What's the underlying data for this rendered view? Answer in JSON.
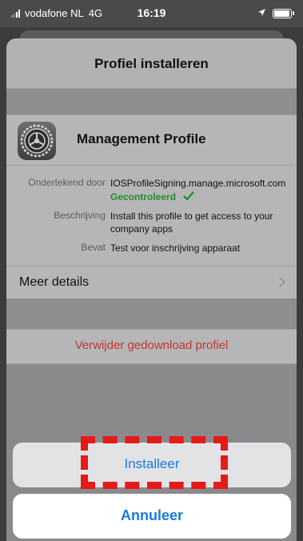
{
  "status_bar": {
    "carrier": "vodafone NL",
    "network": "4G",
    "time": "16:19"
  },
  "sheet": {
    "title": "Profiel installeren",
    "profile": {
      "name": "Management Profile",
      "icon": "settings-gear-icon"
    },
    "details": [
      {
        "label": "Ondertekend door",
        "value": "IOSProfileSigning.manage.microsoft.com"
      },
      {
        "label": "Beschrijving",
        "value": "Install this profile to get access to your company apps"
      },
      {
        "label": "Bevat",
        "value": "Test voor inschrijving apparaat"
      }
    ],
    "verified_label": "Gecontroleerd",
    "more_details_label": "Meer details",
    "remove_profile_label": "Verwijder gedownload profiel"
  },
  "actions": {
    "install_label": "Installeer",
    "cancel_label": "Annuleer"
  },
  "colors": {
    "accent_blue": "#1a7be0",
    "destructive_red": "#c1372d",
    "verified_green": "#1f8f2a",
    "highlight_red": "#e41b17"
  }
}
